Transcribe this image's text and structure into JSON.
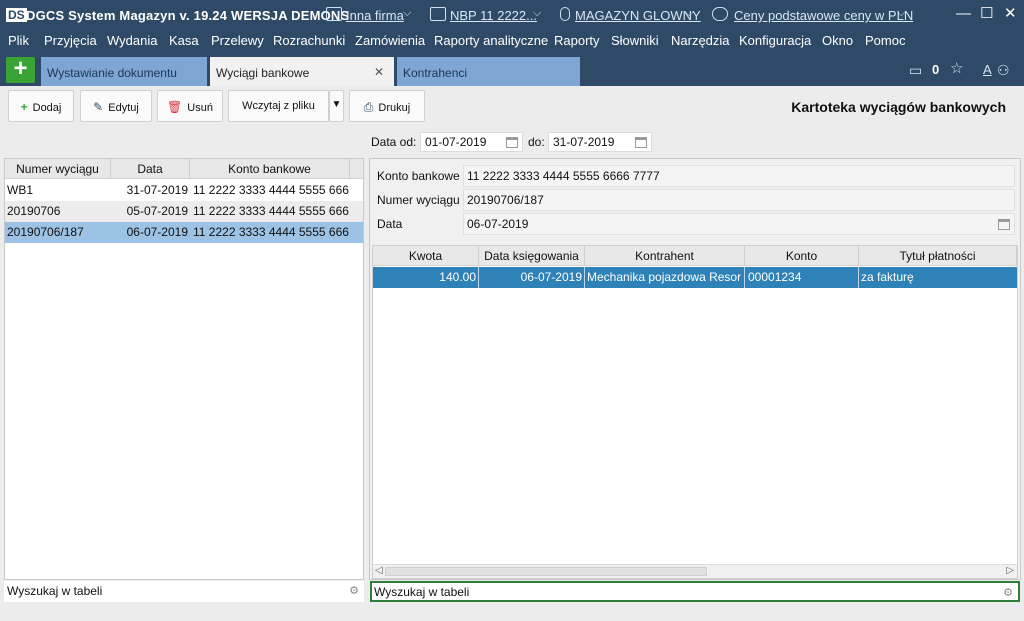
{
  "titlebar": {
    "logo": "DS",
    "app_title": "DGCS System Magazyn  v. 19.24  WERSJA DEMONS",
    "company": "Inna firma",
    "bank": "NBP 11 2222...",
    "warehouse": "MAGAZYN GLOWNY",
    "prices": "Ceny podstawowe ceny w PLN",
    "minimize": "—",
    "maximize": "☐",
    "close": "✕"
  },
  "menu": [
    "Plik",
    "Przyjęcia",
    "Wydania",
    "Kasa",
    "Przelewy",
    "Rozrachunki",
    "Zamówienia",
    "Raporty analityczne",
    "Raporty",
    "Słowniki",
    "Narzędzia",
    "Konfiguracja",
    "Okno",
    "Pomoc"
  ],
  "tabs": {
    "plus": "+",
    "items": [
      "Wystawianie dokumentu",
      "Wyciągi bankowe",
      "Kontrahenci"
    ],
    "close": "✕",
    "counter": "0",
    "font_size": "A"
  },
  "toolbar": {
    "add": "Dodaj",
    "edit": "Edytuj",
    "delete": "Usuń",
    "load": "Wczytaj z pliku",
    "dropdown": "▼",
    "print": "Drukuj"
  },
  "page_title": "Kartoteka wyciągów bankowych",
  "filter": {
    "from_label": "Data od:",
    "from_value": "01-07-2019",
    "to_label": "do:",
    "to_value": "31-07-2019"
  },
  "left_table": {
    "headers": [
      "Numer wyciągu",
      "Data",
      "Konto bankowe"
    ],
    "rows": [
      [
        "WB1",
        "31-07-2019",
        "11 2222 3333 4444 5555 666"
      ],
      [
        "20190706",
        "05-07-2019",
        "11 2222 3333 4444 5555 666"
      ],
      [
        "20190706/187",
        "06-07-2019",
        "11 2222 3333 4444 5555 666"
      ]
    ],
    "search_placeholder": "Wyszukaj w tabeli"
  },
  "details": {
    "account_label": "Konto bankowe",
    "account_value": "11 2222 3333 4444 5555 6666 7777",
    "number_label": "Numer wyciągu",
    "number_value": "20190706/187",
    "date_label": "Data",
    "date_value": "06-07-2019"
  },
  "right_table": {
    "headers": [
      "Kwota",
      "Data księgowania",
      "Kontrahent",
      "Konto",
      "Tytuł płatności"
    ],
    "rows": [
      [
        "140.00",
        "06-07-2019",
        "Mechanika pojazdowa Resor",
        "00001234",
        "za fakturę"
      ]
    ],
    "search_placeholder": "Wyszukaj w tabeli"
  },
  "colors": {
    "header_bg": "#2e4a66",
    "tab_bg": "#7da6d4",
    "selected_row": "#9cc2e5",
    "active_row": "#2f82b8",
    "add_button": "#3aa335"
  }
}
